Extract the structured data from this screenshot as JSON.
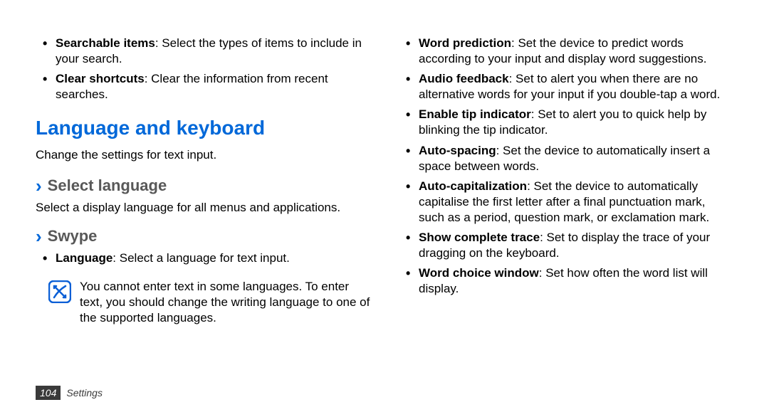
{
  "left": {
    "topBullets": [
      {
        "bold": "Searchable items",
        "text": ": Select the types of items to include in your search."
      },
      {
        "bold": "Clear shortcuts",
        "text": ": Clear the information from recent searches."
      }
    ],
    "heading": "Language and keyboard",
    "intro": "Change the settings for text input.",
    "selectLanguage": {
      "title": "Select language",
      "desc": "Select a display language for all menus and applications."
    },
    "swype": {
      "title": "Swype",
      "bullets": [
        {
          "bold": "Language",
          "text": ": Select a language for text input."
        }
      ],
      "note": "You cannot enter text in some languages. To enter text, you should change the writing language to one of the supported languages."
    }
  },
  "right": {
    "bullets": [
      {
        "bold": "Word prediction",
        "text": ": Set the device to predict words according to your input and display word suggestions."
      },
      {
        "bold": "Audio feedback",
        "text": ": Set to alert you when there are no alternative words for your input if you double-tap a word."
      },
      {
        "bold": "Enable tip indicator",
        "text": ": Set to alert you to quick help by blinking the tip indicator."
      },
      {
        "bold": "Auto-spacing",
        "text": ": Set the device to automatically insert a space between words."
      },
      {
        "bold": "Auto-capitalization",
        "text": ": Set the device to automatically capitalise the first letter after a final punctuation mark, such as a period, question mark, or exclamation mark."
      },
      {
        "bold": "Show complete trace",
        "text": ": Set to display the trace of your dragging on the keyboard."
      },
      {
        "bold": "Word choice window",
        "text": ": Set how often the word list will display."
      }
    ]
  },
  "footer": {
    "page": "104",
    "section": "Settings"
  }
}
